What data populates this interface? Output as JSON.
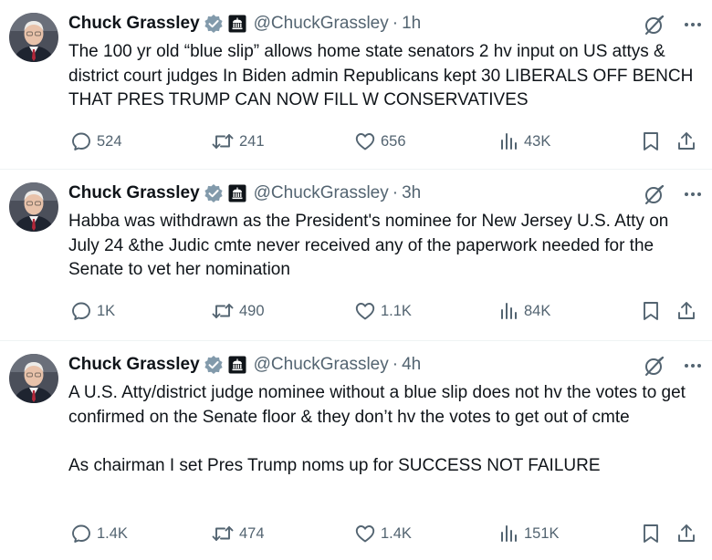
{
  "tweets": [
    {
      "name": "Chuck Grassley",
      "handle": "@ChuckGrassley",
      "time": "1h",
      "text": "The 100 yr old “blue slip” allows home state senators 2 hv input on US attys & district court judges In Biden admin Republicans kept 30 LIBERALS OFF BENCH THAT PRES TRUMP CAN NOW FILL W CONSERVATIVES",
      "replies": "524",
      "reposts": "241",
      "likes": "656",
      "views": "43K"
    },
    {
      "name": "Chuck Grassley",
      "handle": "@ChuckGrassley",
      "time": "3h",
      "text": "Habba was withdrawn as the President's nominee for New Jersey U.S. Atty on July 24 &the Judic cmte never received any of the paperwork needed for the Senate to vet her nomination",
      "replies": "1K",
      "reposts": "490",
      "likes": "1.1K",
      "views": "84K"
    },
    {
      "name": "Chuck Grassley",
      "handle": "@ChuckGrassley",
      "time": "4h",
      "text": "A U.S. Atty/district judge nominee without a blue slip does not hv the votes to get confirmed on the Senate floor & they don’t hv the votes to get out of cmte\n\nAs chairman I set Pres Trump noms up for SUCCESS NOT FAILURE",
      "replies": "1.4K",
      "reposts": "474",
      "likes": "1.4K",
      "views": "151K"
    }
  ],
  "separator": "·",
  "icons": {
    "verified": "verified-badge-icon",
    "affiliation": "government-building-icon",
    "grok": "grok-icon",
    "more": "more-icon",
    "reply": "reply-icon",
    "repost": "repost-icon",
    "like": "heart-icon",
    "views": "views-icon",
    "bookmark": "bookmark-icon",
    "share": "share-icon"
  },
  "colors": {
    "text": "#0f1419",
    "secondary": "#536471",
    "verified": "#829aab",
    "divider": "#eff3f4"
  }
}
